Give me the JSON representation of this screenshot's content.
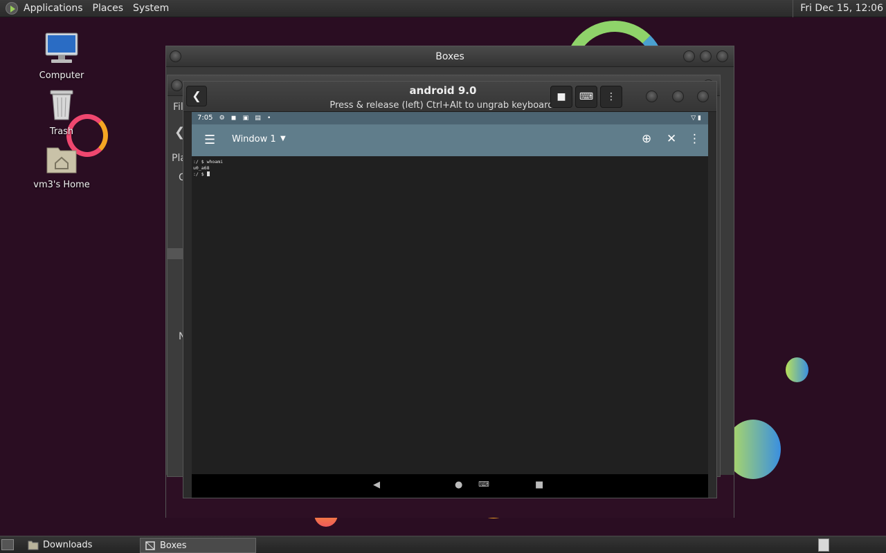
{
  "top_panel": {
    "menus": [
      "Applications",
      "Places",
      "System"
    ],
    "clock": "Fri Dec 15, 12:06"
  },
  "desktop_icons": [
    {
      "label": "Computer",
      "icon": "computer-icon"
    },
    {
      "label": "Trash",
      "icon": "trash-icon"
    },
    {
      "label": "vm3's Home",
      "icon": "home-folder-icon"
    }
  ],
  "boxes_window": {
    "title": "Boxes",
    "fragments": [
      "Fil",
      "Pla",
      "C",
      "N"
    ]
  },
  "vm_window": {
    "title": "android 9.0",
    "subtitle": "Press & release (left) Ctrl+Alt to ungrab keyboard.",
    "buttons": [
      "stop-icon",
      "keyboard-icon",
      "kebab-menu-icon"
    ]
  },
  "android": {
    "status_time": "7:05",
    "status_icons": [
      "gear-icon",
      "shield-icon",
      "a-icon",
      "sd-icon",
      "dot"
    ],
    "window_title": "Window 1",
    "terminal_lines": [
      ":/ $ whoami",
      "u0_a68",
      ":/ $ "
    ],
    "nav_icons": [
      "back-icon",
      "home-icon",
      "keyboard-icon",
      "recents-icon"
    ]
  },
  "taskbar": {
    "tasks": [
      {
        "label": "Downloads",
        "icon": "folder-icon"
      },
      {
        "label": "Boxes",
        "icon": "boxes-icon"
      }
    ]
  },
  "colors": {
    "wallpaper": "#2a0d22",
    "android_appbar": "#607d8b",
    "android_statusbar": "#4c6472",
    "terminal_bg": "#202020"
  }
}
